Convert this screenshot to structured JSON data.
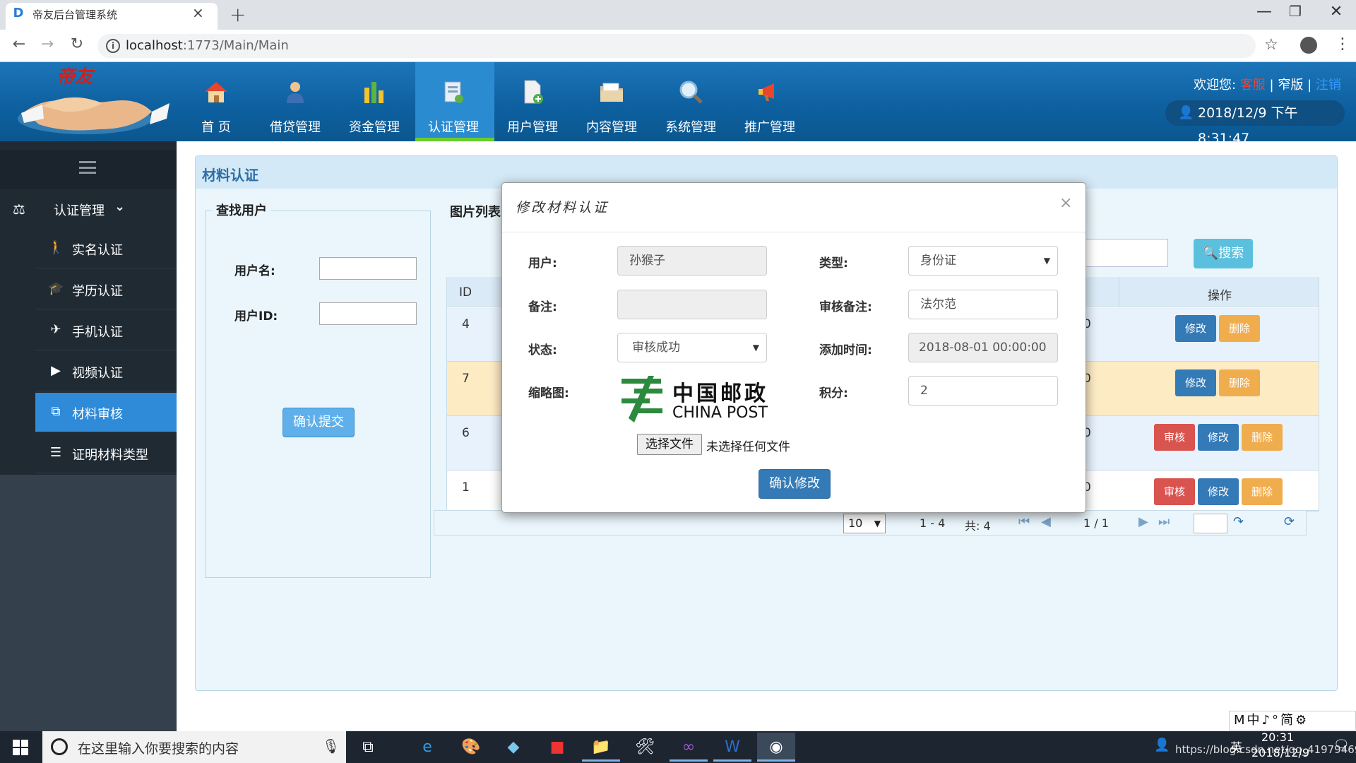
{
  "browser": {
    "tab_title": "帝友后台管理系统",
    "url_host": "localhost",
    "url_rest": ":1773/Main/Main"
  },
  "header": {
    "logo_text": "帝友",
    "nav": [
      {
        "label": "首 页",
        "icon": "home-icon"
      },
      {
        "label": "借贷管理",
        "icon": "user-icon"
      },
      {
        "label": "资金管理",
        "icon": "bar-chart-icon"
      },
      {
        "label": "认证管理",
        "icon": "certificate-icon"
      },
      {
        "label": "用户管理",
        "icon": "add-document-icon"
      },
      {
        "label": "内容管理",
        "icon": "folder-icon"
      },
      {
        "label": "系统管理",
        "icon": "magnifier-icon"
      },
      {
        "label": "推广管理",
        "icon": "megaphone-icon"
      }
    ],
    "active_nav": "认证管理",
    "welcome_prefix": "欢迎您:",
    "welcome_link1": "客服",
    "welcome_sep": "|",
    "welcome_link2": "窄版",
    "welcome_link3": "注销",
    "datetime": "2018/12/9 下午8:31:47"
  },
  "sidebar": {
    "group_label": "认证管理",
    "items": [
      {
        "label": "实名认证",
        "icon": "walking-person-icon"
      },
      {
        "label": "学历认证",
        "icon": "graduation-cap-icon"
      },
      {
        "label": "手机认证",
        "icon": "plane-icon"
      },
      {
        "label": "视频认证",
        "icon": "video-icon"
      },
      {
        "label": "材料审核",
        "icon": "copy-icon"
      },
      {
        "label": "证明材料类型",
        "icon": "list-icon"
      }
    ],
    "active_item": "材料审核"
  },
  "panel": {
    "title": "材料认证",
    "search_legend": "查找用户",
    "username_label": "用户名:",
    "userid_label": "用户ID:",
    "submit_label": "确认提交",
    "list_legend": "图片列表",
    "search_button": "搜索"
  },
  "table": {
    "header_id": "ID",
    "header_ops": "操作",
    "rows": [
      {
        "id": "4",
        "partial": "0",
        "ops": [
          "修改",
          "删除"
        ]
      },
      {
        "id": "7",
        "partial": "0",
        "ops": [
          "修改",
          "删除"
        ]
      },
      {
        "id": "6",
        "partial": "0",
        "ops": [
          "审核",
          "修改",
          "删除"
        ]
      },
      {
        "id": "1",
        "partial": "0",
        "ops": [
          "审核",
          "修改",
          "删除"
        ]
      }
    ]
  },
  "pager": {
    "page_size": "10",
    "range": "1 - 4",
    "total": "共: 4",
    "page": "1 / 1"
  },
  "modal": {
    "title": "修改材料认证",
    "user_label": "用户:",
    "user_value": "孙猴子",
    "type_label": "类型:",
    "type_value": "身份证",
    "remark_label": "备注:",
    "remark_value": "",
    "review_remark_label": "审核备注:",
    "review_remark_value": "法尔范",
    "status_label": "状态:",
    "status_value": "审核成功",
    "add_time_label": "添加时间:",
    "add_time_value": "2018-08-01 00:00:00",
    "thumb_label": "缩略图:",
    "points_label": "积分:",
    "points_value": "2",
    "logo_cn": "中国邮政",
    "logo_en": "CHINA POST",
    "file_button": "选择文件",
    "file_none": "未选择任何文件",
    "confirm_label": "确认修改"
  },
  "ime_bar": "M中♪°简⚙",
  "taskbar": {
    "search_placeholder": "在这里输入你要搜索的内容",
    "clock_time": "20:31",
    "clock_date": "2018/12/9",
    "lang": "英",
    "watermark": "https://blog.csdn.net/qq_41979469"
  }
}
